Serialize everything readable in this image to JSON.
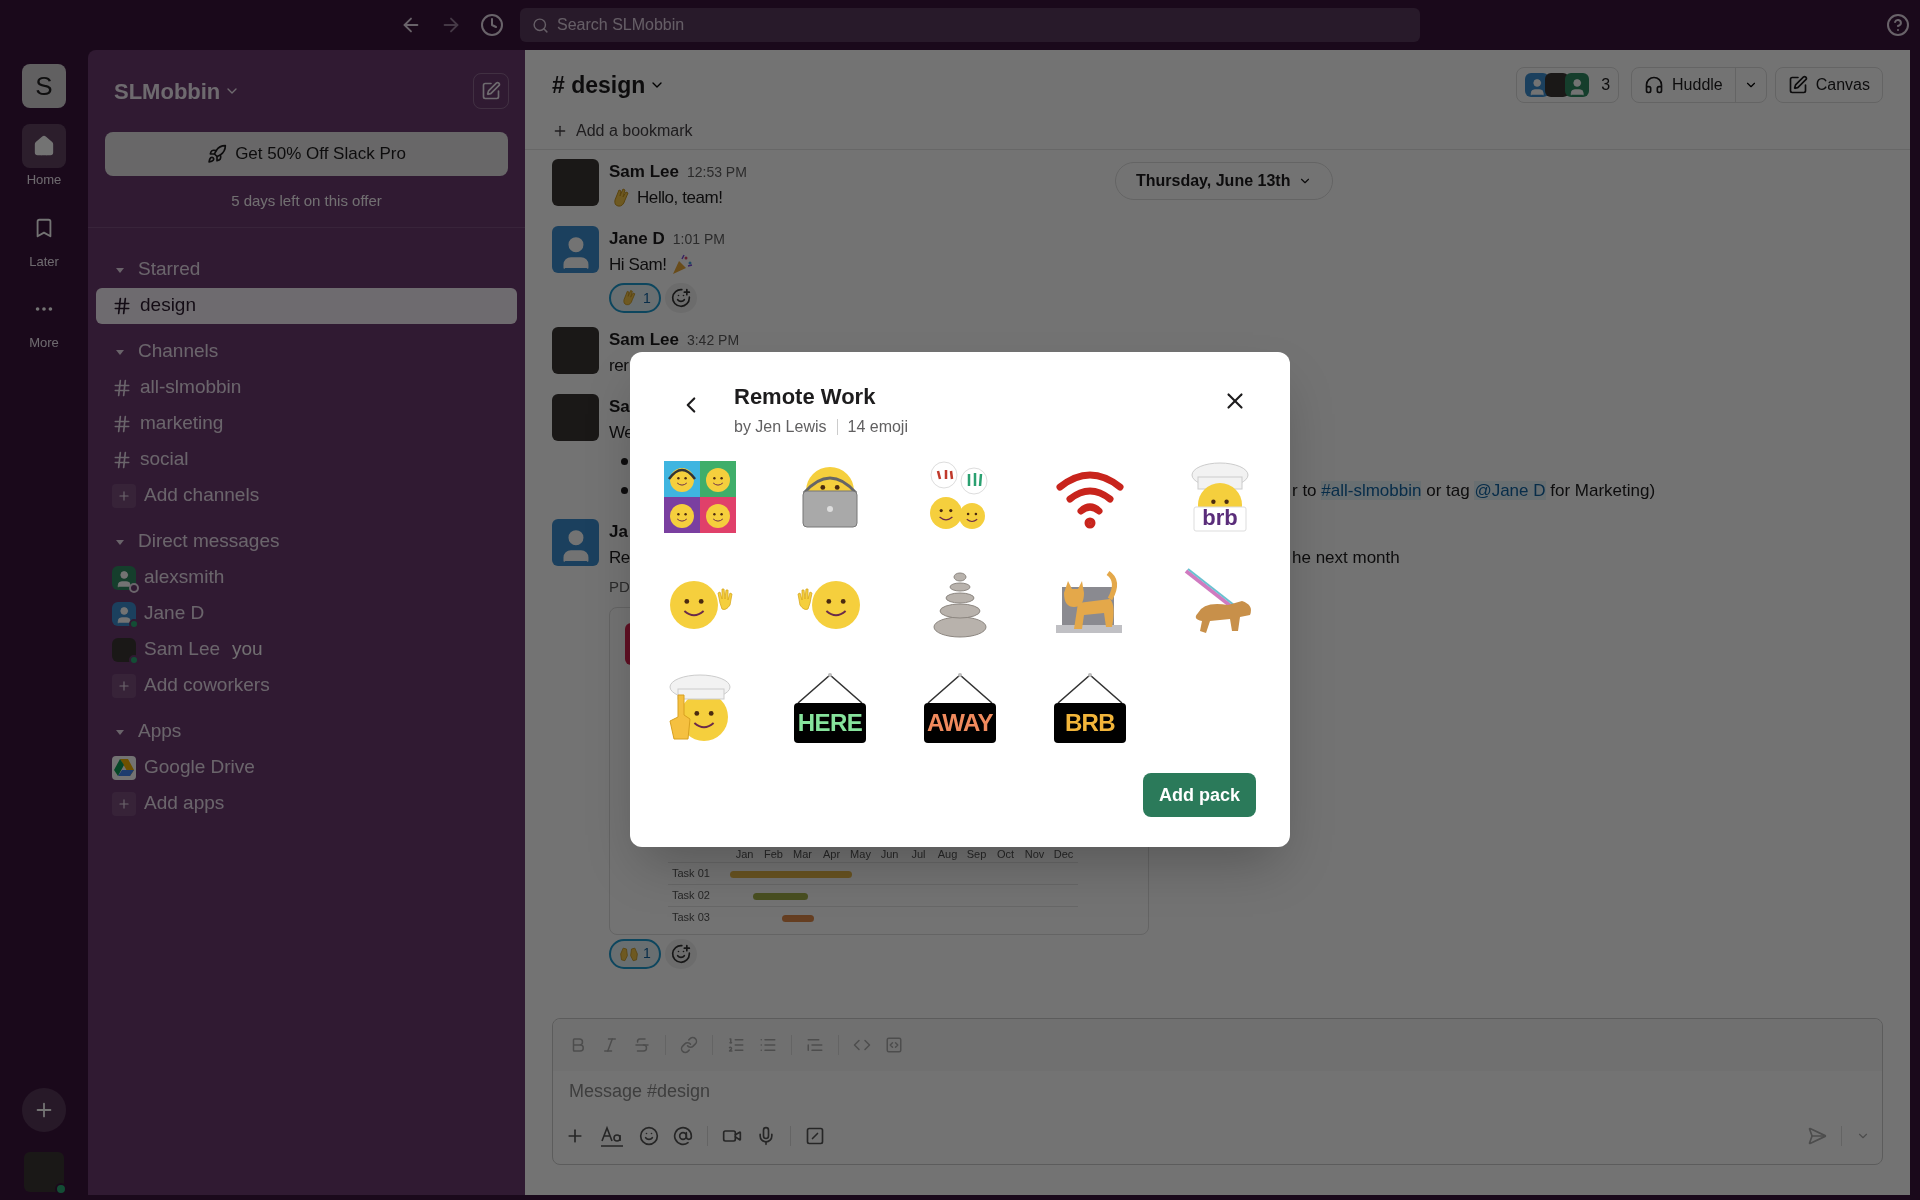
{
  "topbar": {
    "search_placeholder": "Search SLMobbin"
  },
  "rail": {
    "workspace_initial": "S",
    "items": [
      {
        "label": "Home",
        "kind": "home",
        "selected": true
      },
      {
        "label": "Later",
        "kind": "bookmark",
        "selected": false
      },
      {
        "label": "More",
        "kind": "more",
        "selected": false
      }
    ]
  },
  "sidebar": {
    "workspace": "SLMobbin",
    "promo": {
      "button": "Get 50% Off Slack Pro",
      "note": "5 days left on this offer"
    },
    "sections": [
      {
        "title": "Starred",
        "expanded": true,
        "items": [
          {
            "kind": "channel",
            "label": "design",
            "selected": true
          }
        ]
      },
      {
        "title": "Channels",
        "expanded": true,
        "items": [
          {
            "kind": "channel",
            "label": "all-slmobbin",
            "selected": false
          },
          {
            "kind": "channel",
            "label": "marketing",
            "selected": false
          },
          {
            "kind": "channel",
            "label": "social",
            "selected": false
          },
          {
            "kind": "add",
            "label": "Add channels"
          }
        ]
      },
      {
        "title": "Direct messages",
        "expanded": true,
        "items": [
          {
            "kind": "person",
            "label": "alexsmith",
            "avatar": {
              "kind": "alternate"
            },
            "online": false,
            "selected": false
          },
          {
            "kind": "person",
            "label": "Jane D",
            "avatar": {
              "kind": "default"
            },
            "online": true,
            "selected": false
          },
          {
            "kind": "person",
            "label": "Sam Lee",
            "suffix": "you",
            "avatar": {
              "kind": "photo"
            },
            "online": true,
            "selected": false
          },
          {
            "kind": "add",
            "label": "Add coworkers"
          }
        ]
      },
      {
        "title": "Apps",
        "expanded": true,
        "items": [
          {
            "kind": "app",
            "label": "Google Drive",
            "selected": false
          },
          {
            "kind": "add",
            "label": "Add apps"
          }
        ]
      }
    ]
  },
  "channel": {
    "title": "# design",
    "member_count": "3",
    "huddle": "Huddle",
    "canvas": "Canvas",
    "bookmark": "Add a bookmark"
  },
  "date_divider": "Thursday, June 13th",
  "messages": [
    {
      "author": "Sam Lee",
      "time": "12:53 PM",
      "avatar": {
        "kind": "photo"
      },
      "lines": [
        {
          "emoji": {
            "kind": "wave"
          },
          "left": "Hello, team!"
        }
      ]
    },
    {
      "author": "Jane D",
      "time": "1:01 PM",
      "avatar": {
        "kind": "default"
      },
      "lines": [
        {
          "left": "Hi Sam!",
          "emoji_after": {
            "kind": "party"
          }
        }
      ],
      "reactions": [
        {
          "kind": "wave",
          "count": "1",
          "selected": true
        }
      ]
    },
    {
      "author": "Sam Lee",
      "time": "3:42 PM",
      "avatar": {
        "kind": "photo"
      },
      "lines": [
        {
          "left": "rer"
        }
      ]
    },
    {
      "author": "Sa",
      "avatar": {
        "kind": "photo"
      },
      "lines": [
        {
          "left": "We"
        },
        {
          "bullet": true
        },
        {
          "bullet": true,
          "right": [
            {
              "text": "r to "
            },
            {
              "text": "#all-slmobbin",
              "kind": "mention"
            },
            {
              "text": " or tag "
            },
            {
              "text": "@Jane D",
              "kind": "mention"
            },
            {
              "text": " for Marketing)"
            }
          ]
        }
      ]
    },
    {
      "author": "Ja",
      "avatar": {
        "kind": "default"
      },
      "lines": [
        {
          "left": "Re",
          "right": [
            {
              "text": "he next month"
            }
          ]
        }
      ],
      "file_label": "PD",
      "attachment": {
        "months": [
          "Jan",
          "Feb",
          "Mar",
          "Apr",
          "May",
          "Jun",
          "Jul",
          "Aug",
          "Sep",
          "Oct",
          "Nov",
          "Dec"
        ],
        "tasks": [
          {
            "label": "Task 01"
          },
          {
            "label": "Task 02"
          },
          {
            "label": "Task 03"
          }
        ]
      },
      "reactions": [
        {
          "kind": "raised-hands",
          "count": "1",
          "selected": true
        }
      ]
    }
  ],
  "composer": {
    "placeholder": "Message #design"
  },
  "modal": {
    "title": "Remote Work",
    "author": "by Jen Lewis",
    "count": "14 emoji",
    "button": "Add pack",
    "emoji": [
      {
        "kind": "faces-grid"
      },
      {
        "kind": "laptop-face"
      },
      {
        "kind": "puzzled-faces"
      },
      {
        "kind": "broken-wifi"
      },
      {
        "kind": "chef-sign",
        "label": "brb"
      },
      {
        "kind": "waving-face"
      },
      {
        "kind": "waving-face-left"
      },
      {
        "kind": "stacked-stones"
      },
      {
        "kind": "cat-on-laptop"
      },
      {
        "kind": "dog-on-leash"
      },
      {
        "kind": "chef-pointing"
      },
      {
        "kind": "here-sign",
        "label": "HERE"
      },
      {
        "kind": "away-sign",
        "label": "AWAY"
      },
      {
        "kind": "brb-sign",
        "label": "BRB"
      }
    ]
  }
}
